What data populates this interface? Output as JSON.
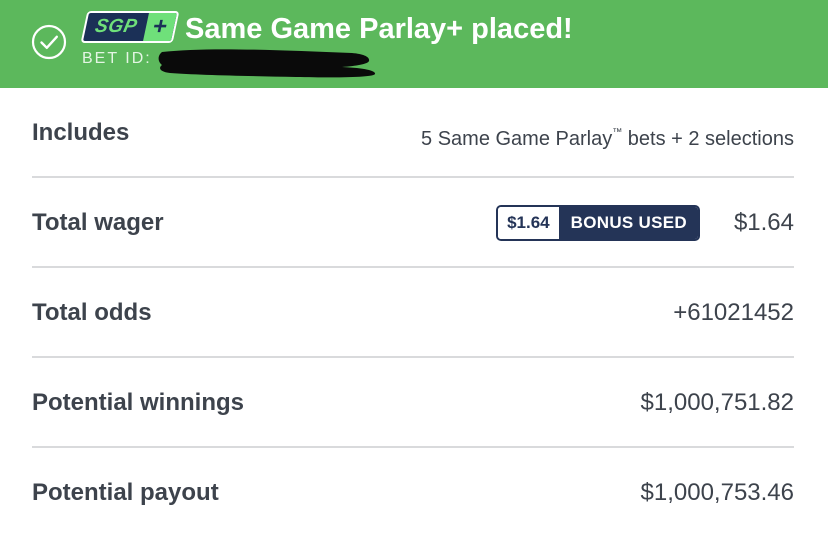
{
  "banner": {
    "badge_text": "SGP",
    "badge_plus": "+",
    "title": "Same Game Parlay+ placed!",
    "bet_id_label": "BET ID:",
    "background": "#5cb85c",
    "icons": {
      "status": "check-circle-icon"
    }
  },
  "summary": {
    "includes": {
      "label": "Includes",
      "value_prefix": "5 Same Game Parlay",
      "trademark": "™",
      "value_suffix": " bets + 2 selections"
    },
    "total_wager": {
      "label": "Total wager",
      "bonus_amount": "$1.64",
      "bonus_label": "BONUS USED",
      "value": "$1.64"
    },
    "total_odds": {
      "label": "Total odds",
      "value": "+61021452"
    },
    "potential_winnings": {
      "label": "Potential winnings",
      "value": "$1,000,751.82"
    },
    "potential_payout": {
      "label": "Potential payout",
      "value": "$1,000,753.46"
    }
  },
  "colors": {
    "accent_green": "#6fe07a",
    "navy": "#243457",
    "text": "#3d434c",
    "divider": "#d9dadc"
  }
}
